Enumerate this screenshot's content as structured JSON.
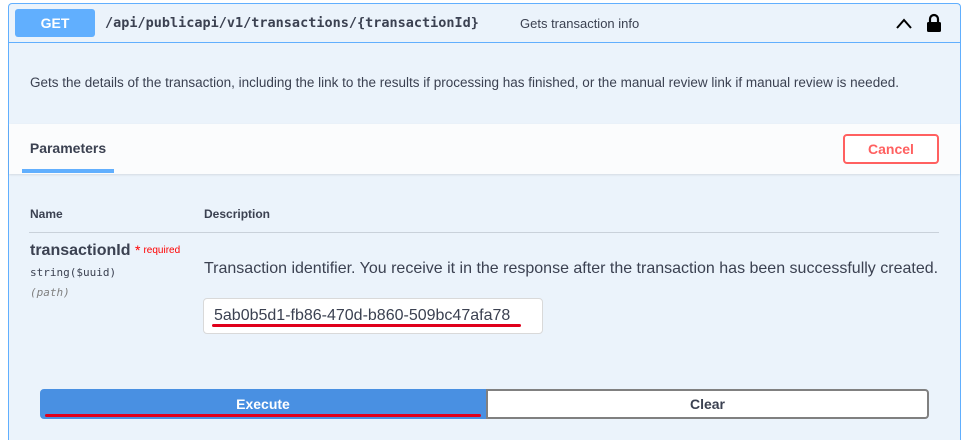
{
  "operation": {
    "method": "GET",
    "path": "/api/publicapi/v1/transactions/{transactionId}",
    "summary": "Gets transaction info",
    "description": "Gets the details of the transaction, including the link to the results if processing has finished, or the manual review link if manual review is needed.",
    "icons": {
      "collapse": "chevron-up-icon",
      "auth": "lock-icon"
    }
  },
  "parameters_section": {
    "tab_label": "Parameters",
    "cancel_label": "Cancel",
    "columns": {
      "name": "Name",
      "description": "Description"
    },
    "params": [
      {
        "name": "transactionId",
        "required_label": "required",
        "type": "string($uuid)",
        "in": "(path)",
        "description": "Transaction identifier. You receive it in the response after the transaction has been successfully created.",
        "value": "5ab0b5d1-fb86-470d-b860-509bc47afa78"
      }
    ]
  },
  "actions": {
    "execute_label": "Execute",
    "clear_label": "Clear"
  },
  "colors": {
    "method_accent": "#61affe",
    "execute": "#4990e2",
    "cancel": "#ff6060",
    "annotation": "#e0001b"
  }
}
